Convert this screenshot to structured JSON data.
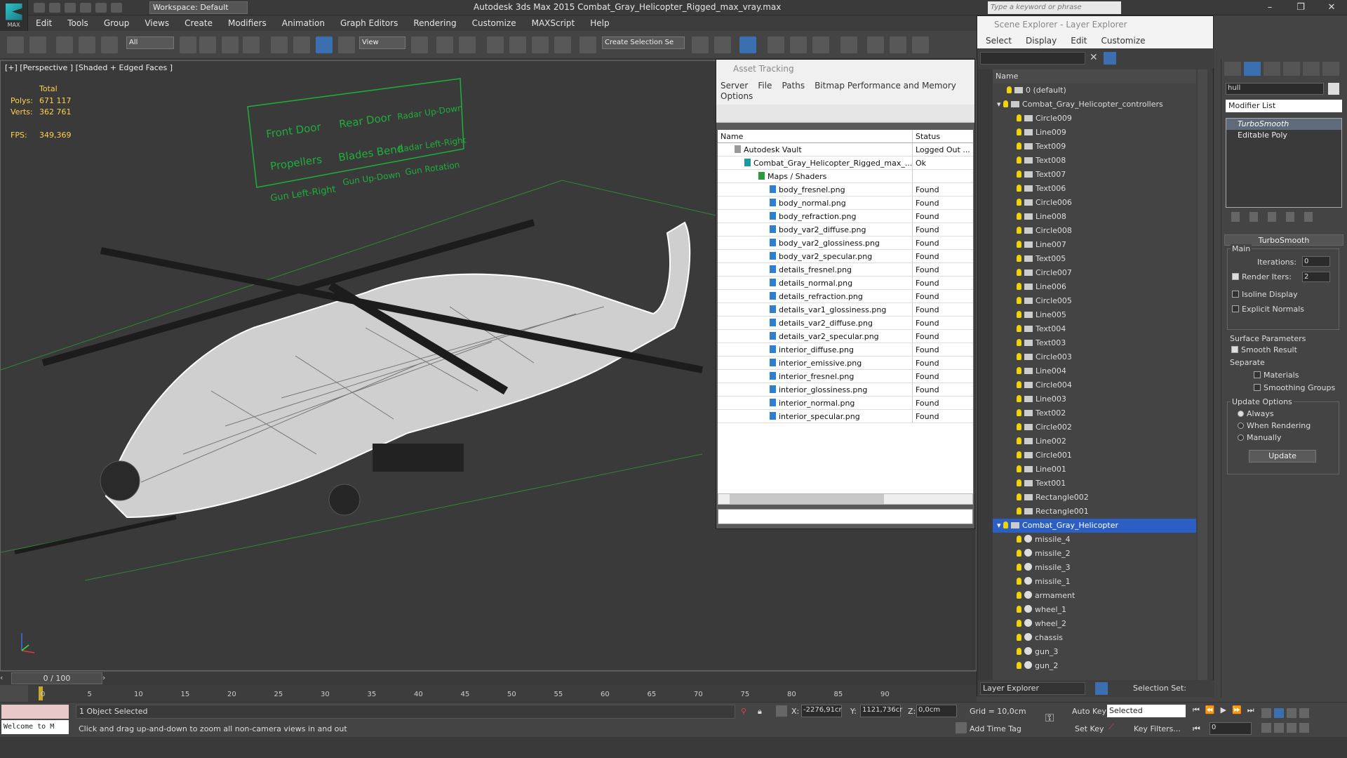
{
  "app": {
    "title": "Autodesk 3ds Max  2015     Combat_Gray_Helicopter_Rigged_max_vray.max",
    "logo": "MAX",
    "workspace": "Workspace: Default",
    "search_placeholder": "Type a keyword or phrase"
  },
  "menu": [
    "Edit",
    "Tools",
    "Group",
    "Views",
    "Create",
    "Modifiers",
    "Animation",
    "Graph Editors",
    "Rendering",
    "Customize",
    "MAXScript",
    "Help"
  ],
  "toolbar": {
    "filter": "All",
    "refcoord": "View",
    "selection_set": "Create Selection Se"
  },
  "viewport": {
    "label": "[+] [Perspective ] [Shaded + Edged Faces ]",
    "stats": {
      "total_label": "Total",
      "polys_label": "Polys:",
      "polys": "671 117",
      "verts_label": "Verts:",
      "verts": "362 761",
      "fps_label": "FPS:",
      "fps": "349,369"
    },
    "controls": [
      "Front Door",
      "Rear Door",
      "Radar Up-Down",
      "Propellers",
      "Blades Bend",
      "Radar Left-Right",
      "Gun Left-Right",
      "Gun Up-Down",
      "Gun Rotation"
    ]
  },
  "asset_tracking": {
    "title": "Asset Tracking",
    "menu": [
      "Server",
      "File",
      "Paths",
      "Bitmap Performance and Memory",
      "Options"
    ],
    "columns": [
      "Name",
      "Status"
    ],
    "rows": [
      {
        "name": "Autodesk Vault",
        "status": "Logged Out ..."
      },
      {
        "name": "Combat_Gray_Helicopter_Rigged_max_...",
        "status": "Ok"
      },
      {
        "name": "Maps / Shaders",
        "status": ""
      },
      {
        "name": "body_fresnel.png",
        "status": "Found"
      },
      {
        "name": "body_normal.png",
        "status": "Found"
      },
      {
        "name": "body_refraction.png",
        "status": "Found"
      },
      {
        "name": "body_var2_diffuse.png",
        "status": "Found"
      },
      {
        "name": "body_var2_glossiness.png",
        "status": "Found"
      },
      {
        "name": "body_var2_specular.png",
        "status": "Found"
      },
      {
        "name": "details_fresnel.png",
        "status": "Found"
      },
      {
        "name": "details_normal.png",
        "status": "Found"
      },
      {
        "name": "details_refraction.png",
        "status": "Found"
      },
      {
        "name": "details_var1_glossiness.png",
        "status": "Found"
      },
      {
        "name": "details_var2_diffuse.png",
        "status": "Found"
      },
      {
        "name": "details_var2_specular.png",
        "status": "Found"
      },
      {
        "name": "interior_diffuse.png",
        "status": "Found"
      },
      {
        "name": "interior_emissive.png",
        "status": "Found"
      },
      {
        "name": "interior_fresnel.png",
        "status": "Found"
      },
      {
        "name": "interior_glossiness.png",
        "status": "Found"
      },
      {
        "name": "interior_normal.png",
        "status": "Found"
      },
      {
        "name": "interior_specular.png",
        "status": "Found"
      }
    ]
  },
  "scene_explorer": {
    "title": "Scene Explorer - Layer Explorer",
    "menu": [
      "Select",
      "Display",
      "Edit",
      "Customize"
    ],
    "column": "Name",
    "layers": [
      "0 (default)",
      "Combat_Gray_Helicopter_controllers"
    ],
    "controllers": [
      "Circle009",
      "Line009",
      "Text009",
      "Text008",
      "Text007",
      "Text006",
      "Circle006",
      "Line008",
      "Circle008",
      "Line007",
      "Text005",
      "Circle007",
      "Line006",
      "Circle005",
      "Line005",
      "Text004",
      "Text003",
      "Circle003",
      "Line004",
      "Circle004",
      "Line003",
      "Text002",
      "Circle002",
      "Line002",
      "Circle001",
      "Line001",
      "Text001",
      "Rectangle002",
      "Rectangle001"
    ],
    "main_layer": "Combat_Gray_Helicopter",
    "objects": [
      "missile_4",
      "missile_2",
      "missile_3",
      "missile_1",
      "armament",
      "wheel_1",
      "wheel_2",
      "chassis",
      "gun_3",
      "gun_2"
    ],
    "footer_left": "Layer Explorer",
    "footer_right": "Selection Set:"
  },
  "command_panel": {
    "object_name": "hull",
    "modifier_list": "Modifier List",
    "stack": [
      "TurboSmooth",
      "Editable Poly"
    ],
    "turbosmooth": {
      "title": "TurboSmooth",
      "main": "Main",
      "iterations_label": "Iterations:",
      "iterations": "0",
      "render_iters_label": "Render Iters:",
      "render_iters": "2",
      "isoline": "Isoline Display",
      "explicit": "Explicit Normals",
      "surface": "Surface Parameters",
      "smooth_result": "Smooth Result",
      "separate": "Separate",
      "materials": "Materials",
      "smoothing_groups": "Smoothing Groups",
      "update_options": "Update Options",
      "always": "Always",
      "when_rendering": "When Rendering",
      "manually": "Manually",
      "update": "Update"
    }
  },
  "timeline": {
    "frame": "0 / 100",
    "ticks": [
      "0",
      "5",
      "10",
      "15",
      "20",
      "25",
      "30",
      "35",
      "40",
      "45",
      "50",
      "55",
      "60",
      "65",
      "70",
      "75",
      "80",
      "85",
      "90"
    ]
  },
  "status": {
    "selected": "1 Object Selected",
    "prompt": "Click and drag up-and-down to zoom all non-camera views in and out",
    "welcome": "Welcome to M",
    "x_label": "X:",
    "x": "-2276,91cr",
    "y_label": "Y:",
    "y": "1121,736cr",
    "z_label": "Z:",
    "z": "0,0cm",
    "grid": "Grid = 10,0cm",
    "auto_key": "Auto Key",
    "set_key": "Set Key",
    "selected_dropdown": "Selected",
    "key_filters": "Key Filters...",
    "add_time_tag": "Add Time Tag",
    "frame_field": "0"
  }
}
